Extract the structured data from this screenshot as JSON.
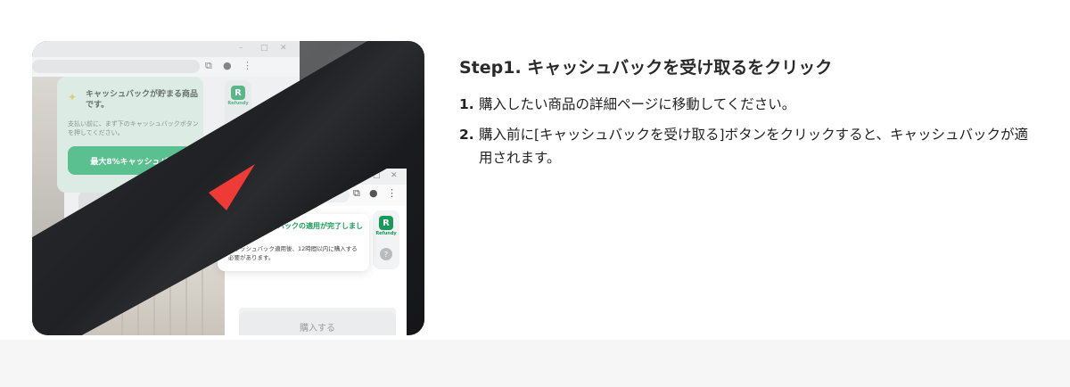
{
  "illustration": {
    "panel_before": {
      "title": "キャッシュバックが貯まる商品です。",
      "description": "支払い前に、まず下のキャッシュバックボタンを押してください。",
      "cta_label": "最大8%キャッシュバック"
    },
    "panel_after": {
      "title": "キャッシュバックの適用が完了しました！",
      "description": "キャッシュバック適用後、12時間以内に購入する必要があります。"
    },
    "buy_button_label": "購入する",
    "extension_logo_text": "Refundy",
    "help_symbol": "?",
    "check_symbol": "✓",
    "sparkle_icon": "✦",
    "colors": {
      "accent_green": "#1da864",
      "arrow_red": "#ef3b36"
    }
  },
  "content": {
    "heading": "Step1. キャッシュバックを受け取るをクリック",
    "steps": [
      {
        "number": "1.",
        "text": "購入したい商品の詳細ページに移動してください。"
      },
      {
        "number": "2.",
        "text": "購入前に[キャッシュバックを受け取る]ボタンをクリックすると、キャッシュバックが適用されます。"
      }
    ]
  }
}
